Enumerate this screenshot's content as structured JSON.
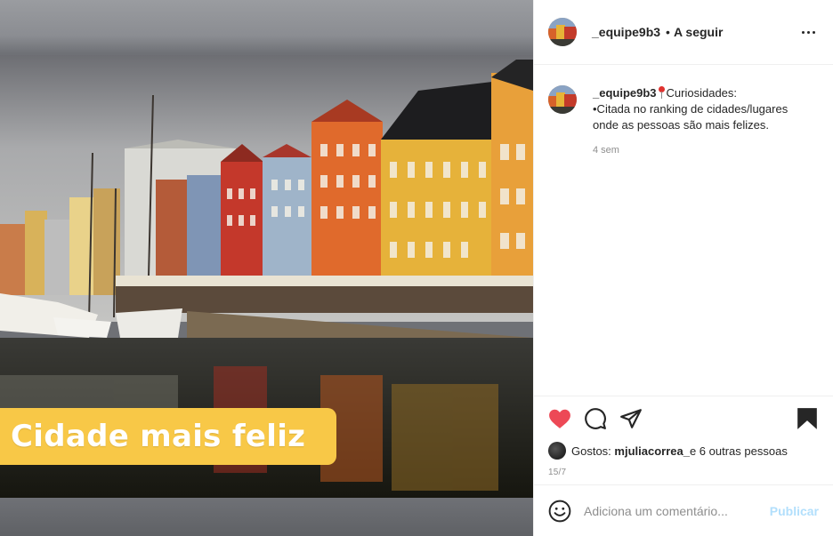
{
  "post": {
    "image_caption": "Cidade mais feliz",
    "header": {
      "username": "_equipe9b3",
      "separator": "•",
      "follow_label": "A seguir",
      "more_icon": "more-options-icon"
    },
    "caption": {
      "username": "_equipe9b3",
      "title": "Curiosidades:",
      "line1": "•Citada no ranking de cidades/lugares",
      "line2": "onde as pessoas são mais felizes.",
      "time": "4 sem"
    },
    "actions": {
      "like_icon": "heart-filled-icon",
      "comment_icon": "comment-icon",
      "share_icon": "share-icon",
      "save_icon": "bookmark-filled-icon",
      "like_color": "#ed4956"
    },
    "likes": {
      "prefix": "Gostos: ",
      "user": "mjuliacorrea_",
      "suffix": " e 6 outras pessoas"
    },
    "date": "15/7",
    "add_comment": {
      "placeholder": "Adiciona um comentário...",
      "publish_label": "Publicar",
      "emoji_icon": "emoji-icon"
    }
  }
}
